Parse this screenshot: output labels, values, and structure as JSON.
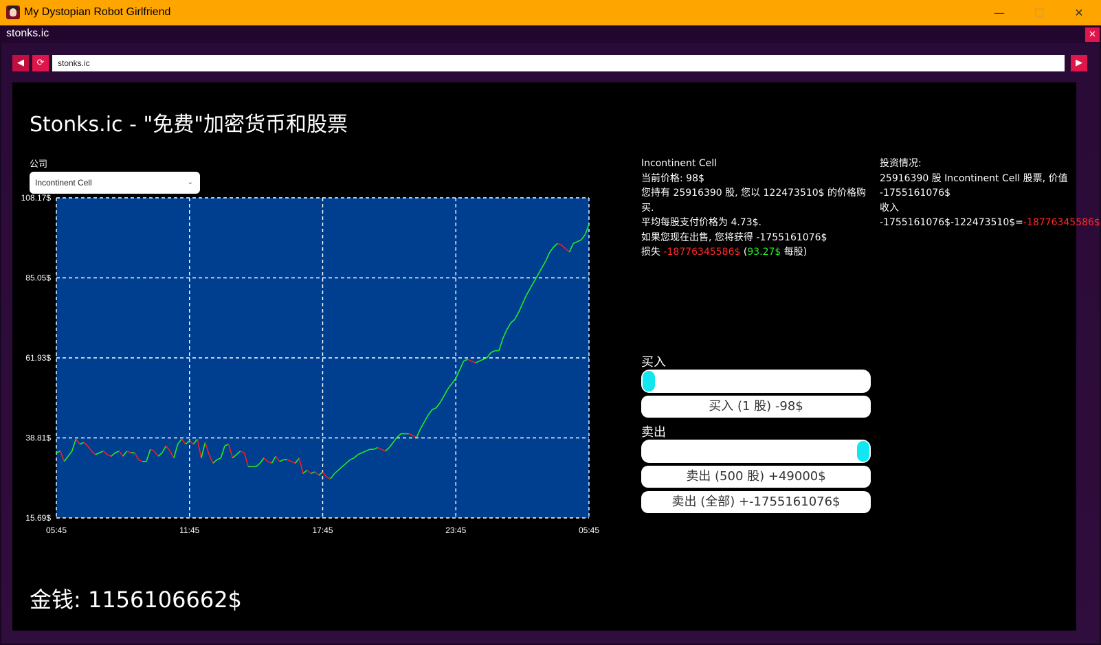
{
  "window": {
    "title": "My Dystopian Robot Girlfriend",
    "min": "—",
    "max": "☐",
    "close": "✕"
  },
  "tab": {
    "title": "stonks.ic",
    "close": "✕"
  },
  "nav": {
    "back": "◀",
    "reload": "⟳",
    "go": "▶",
    "url": "stonks.ic"
  },
  "page": {
    "title": "Stonks.ic - \"免费\"加密货币和股票",
    "company_label": "公司",
    "company_selected": "Incontinent Cell",
    "info": {
      "name": "Incontinent Cell",
      "price": "当前价格: 98$",
      "holding": "您持有 25916390 股, 您以 122473510$ 的价格购买.",
      "avg": "平均每股支付价格为 4.73$.",
      "sell_now": "如果您现在出售, 您将获得 -1755161076$",
      "loss_prefix": "损失 ",
      "loss_value": "-18776345586$",
      "loss_paren_open": " (",
      "loss_per": "93.27$",
      "loss_suffix": " 每股)"
    },
    "investment": {
      "heading": "投资情况:",
      "line1": "25916390 股 Incontinent Cell 股票, 价值 -1755161076$",
      "line2_prefix": "收入 -1755161076$-122473510$=",
      "line2_value": "-18776345586$"
    },
    "buy": {
      "label": "买入",
      "slider": 0.0,
      "button": "买入 (1 股) -98$"
    },
    "sell": {
      "label": "卖出",
      "slider": 1.0,
      "button": "卖出 (500 股) +49000$",
      "all_button": "卖出 (全部) +-1755161076$"
    },
    "money": "金钱: 1156106662$"
  },
  "colors": {
    "titlebar": "#ffa500",
    "accent": "#e0154a",
    "chart_bg": "#003f8f",
    "up": "#22ee22",
    "down": "#ff1a1a",
    "knob": "#12e6f0"
  },
  "chart_data": {
    "type": "line",
    "ylabels": [
      "108.17$",
      "85.05$",
      "61.93$",
      "38.81$",
      "15.69$"
    ],
    "xlabels": [
      "05:45",
      "11:45",
      "17:45",
      "23:45",
      "05:45"
    ],
    "ylim": [
      15.69,
      108.17
    ],
    "grid": true,
    "series": [
      {
        "values": [
          34.5,
          35.0,
          32.0,
          33.5,
          35.0,
          38.5,
          37.0,
          37.5,
          36.5,
          35.0,
          34.0,
          34.5,
          35.0,
          34.0,
          33.5,
          34.5,
          35.0,
          33.5,
          35.0,
          34.5,
          34.5,
          32.5,
          32.0,
          32.0,
          35.5,
          35.0,
          33.5,
          34.5,
          36.5,
          35.0,
          33.0,
          37.0,
          38.5,
          37.0,
          38.0,
          37.0,
          38.5,
          33.0,
          37.5,
          34.0,
          31.5,
          32.5,
          33.0,
          36.5,
          37.0,
          33.0,
          34.0,
          35.0,
          34.5,
          30.5,
          30.5,
          30.5,
          31.5,
          33.0,
          32.0,
          31.5,
          33.5,
          32.0,
          32.5,
          32.5,
          32.0,
          31.5,
          33.0,
          28.5,
          29.5,
          28.5,
          29.0,
          28.0,
          29.0,
          27.5,
          27.0,
          28.5,
          29.5,
          30.5,
          31.5,
          32.5,
          33.0,
          34.0,
          34.5,
          35.0,
          35.5,
          35.5,
          36.0,
          35.5,
          35.0,
          36.0,
          37.5,
          39.0,
          40.0,
          40.0,
          40.0,
          39.5,
          39.0,
          41.5,
          43.5,
          45.5,
          47.0,
          47.5,
          49.0,
          51.0,
          53.0,
          54.5,
          56.0,
          58.5,
          61.0,
          61.5,
          61.0,
          60.5,
          61.0,
          61.5,
          62.0,
          63.5,
          64.0,
          64.0,
          67.5,
          70.0,
          72.0,
          73.0,
          75.0,
          77.5,
          80.0,
          82.0,
          84.0,
          86.0,
          88.0,
          90.0,
          92.5,
          94.0,
          95.0,
          94.5,
          93.5,
          92.5,
          95.0,
          95.5,
          96.0,
          97.5,
          100.5
        ]
      }
    ]
  }
}
